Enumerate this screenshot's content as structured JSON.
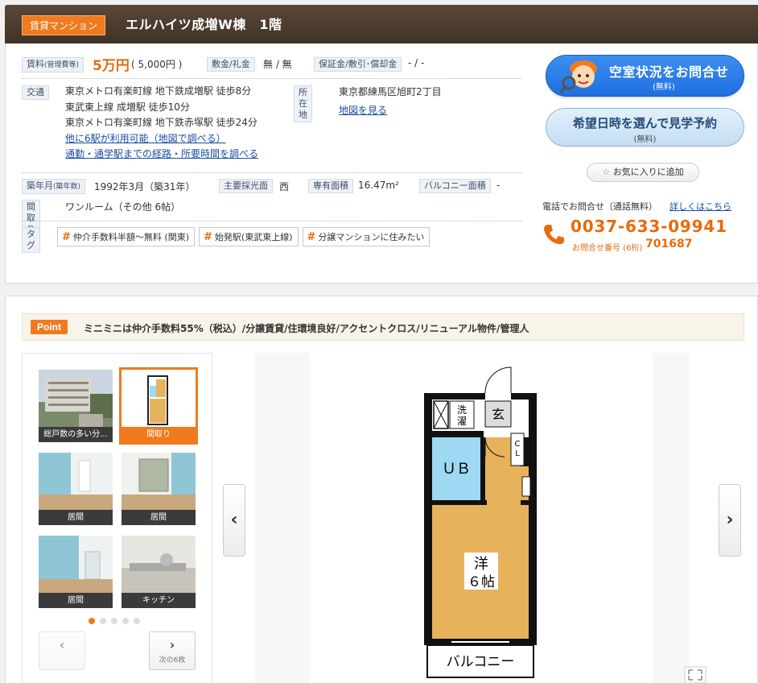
{
  "header": {
    "category": "賃貸マンション",
    "title": "エルハイツ成増W棟　1階"
  },
  "fees": {
    "rent_label": "賃料",
    "rent_label_sub": "(管理費等)",
    "rent": "5万円",
    "mgmt": "( 5,000円 )",
    "deposit_label": "敷金/礼金",
    "deposit": "無 / 無",
    "guarantee_label": "保証金/敷引･償却金",
    "guarantee": "- / -"
  },
  "access": {
    "label": "交通",
    "lines": [
      "東京メトロ有楽町線 地下鉄成増駅 徒歩8分",
      "東武東上線 成増駅 徒歩10分",
      "東京メトロ有楽町線 地下鉄赤塚駅 徒歩24分"
    ],
    "more_link": "他に6駅が利用可能（地図で調べる）",
    "route_link": "通勤・通学駅までの経路・所要時間を調べる",
    "address_label": "所在地",
    "address": "東京都練馬区旭町2丁目",
    "map_link": "地図を見る"
  },
  "specs": {
    "built_label": "築年月",
    "built_label_sub": "(築年数)",
    "built": "1992年3月（築31年）",
    "light_label": "主要採光面",
    "light": "西",
    "area_label": "専有面積",
    "area": "16.47m²",
    "balcony_label": "バルコニー面積",
    "balcony": "-",
    "madori_label": "間取り",
    "madori": "ワンルーム（その他 6帖）",
    "tag_label": "タグ",
    "tags": [
      "仲介手数料半額～無料 (関東)",
      "始発駅(東武東上線)",
      "分譲マンションに住みたい"
    ]
  },
  "cta": {
    "vacancy_main": "空室状況をお問合せ",
    "vacancy_sub": "(無料)",
    "visit_main": "希望日時を選んで見学予約",
    "visit_sub": "(無料)",
    "favorite": "お気に入りに追加",
    "tel_label": "電話でお問合せ（通話無料）",
    "tel_more": "詳しくはこちら",
    "tel_number": "0037-633-09941",
    "tel_code_label": "お問合せ番号 (6桁)",
    "tel_code": "701687"
  },
  "point": {
    "badge": "Point",
    "text": "ミニミニは仲介手数料55%（税込）/分譲賃貸/住環境良好/アクセントクロス/リニューアル物件/管理人"
  },
  "gallery": {
    "thumbs": [
      {
        "caption": "総戸数の多い分..."
      },
      {
        "caption": "間取り"
      },
      {
        "caption": "居間"
      },
      {
        "caption": "居間"
      },
      {
        "caption": "居間"
      },
      {
        "caption": "キッチン"
      }
    ],
    "prev_arrow": "‹",
    "next_arrow": "›",
    "next_label": "次の6枚",
    "viewer_prev": "‹",
    "viewer_next": "›"
  },
  "floorplan": {
    "washer": "洗濯",
    "entrance": "玄",
    "closet": "CL",
    "bath": "ＵＢ",
    "room_type": "洋",
    "room_size": "６帖",
    "balcony": "バルコニー"
  },
  "colors": {
    "accent": "#f07a1e",
    "link": "#1a4ea1",
    "header_bg": "#4b3c30"
  }
}
